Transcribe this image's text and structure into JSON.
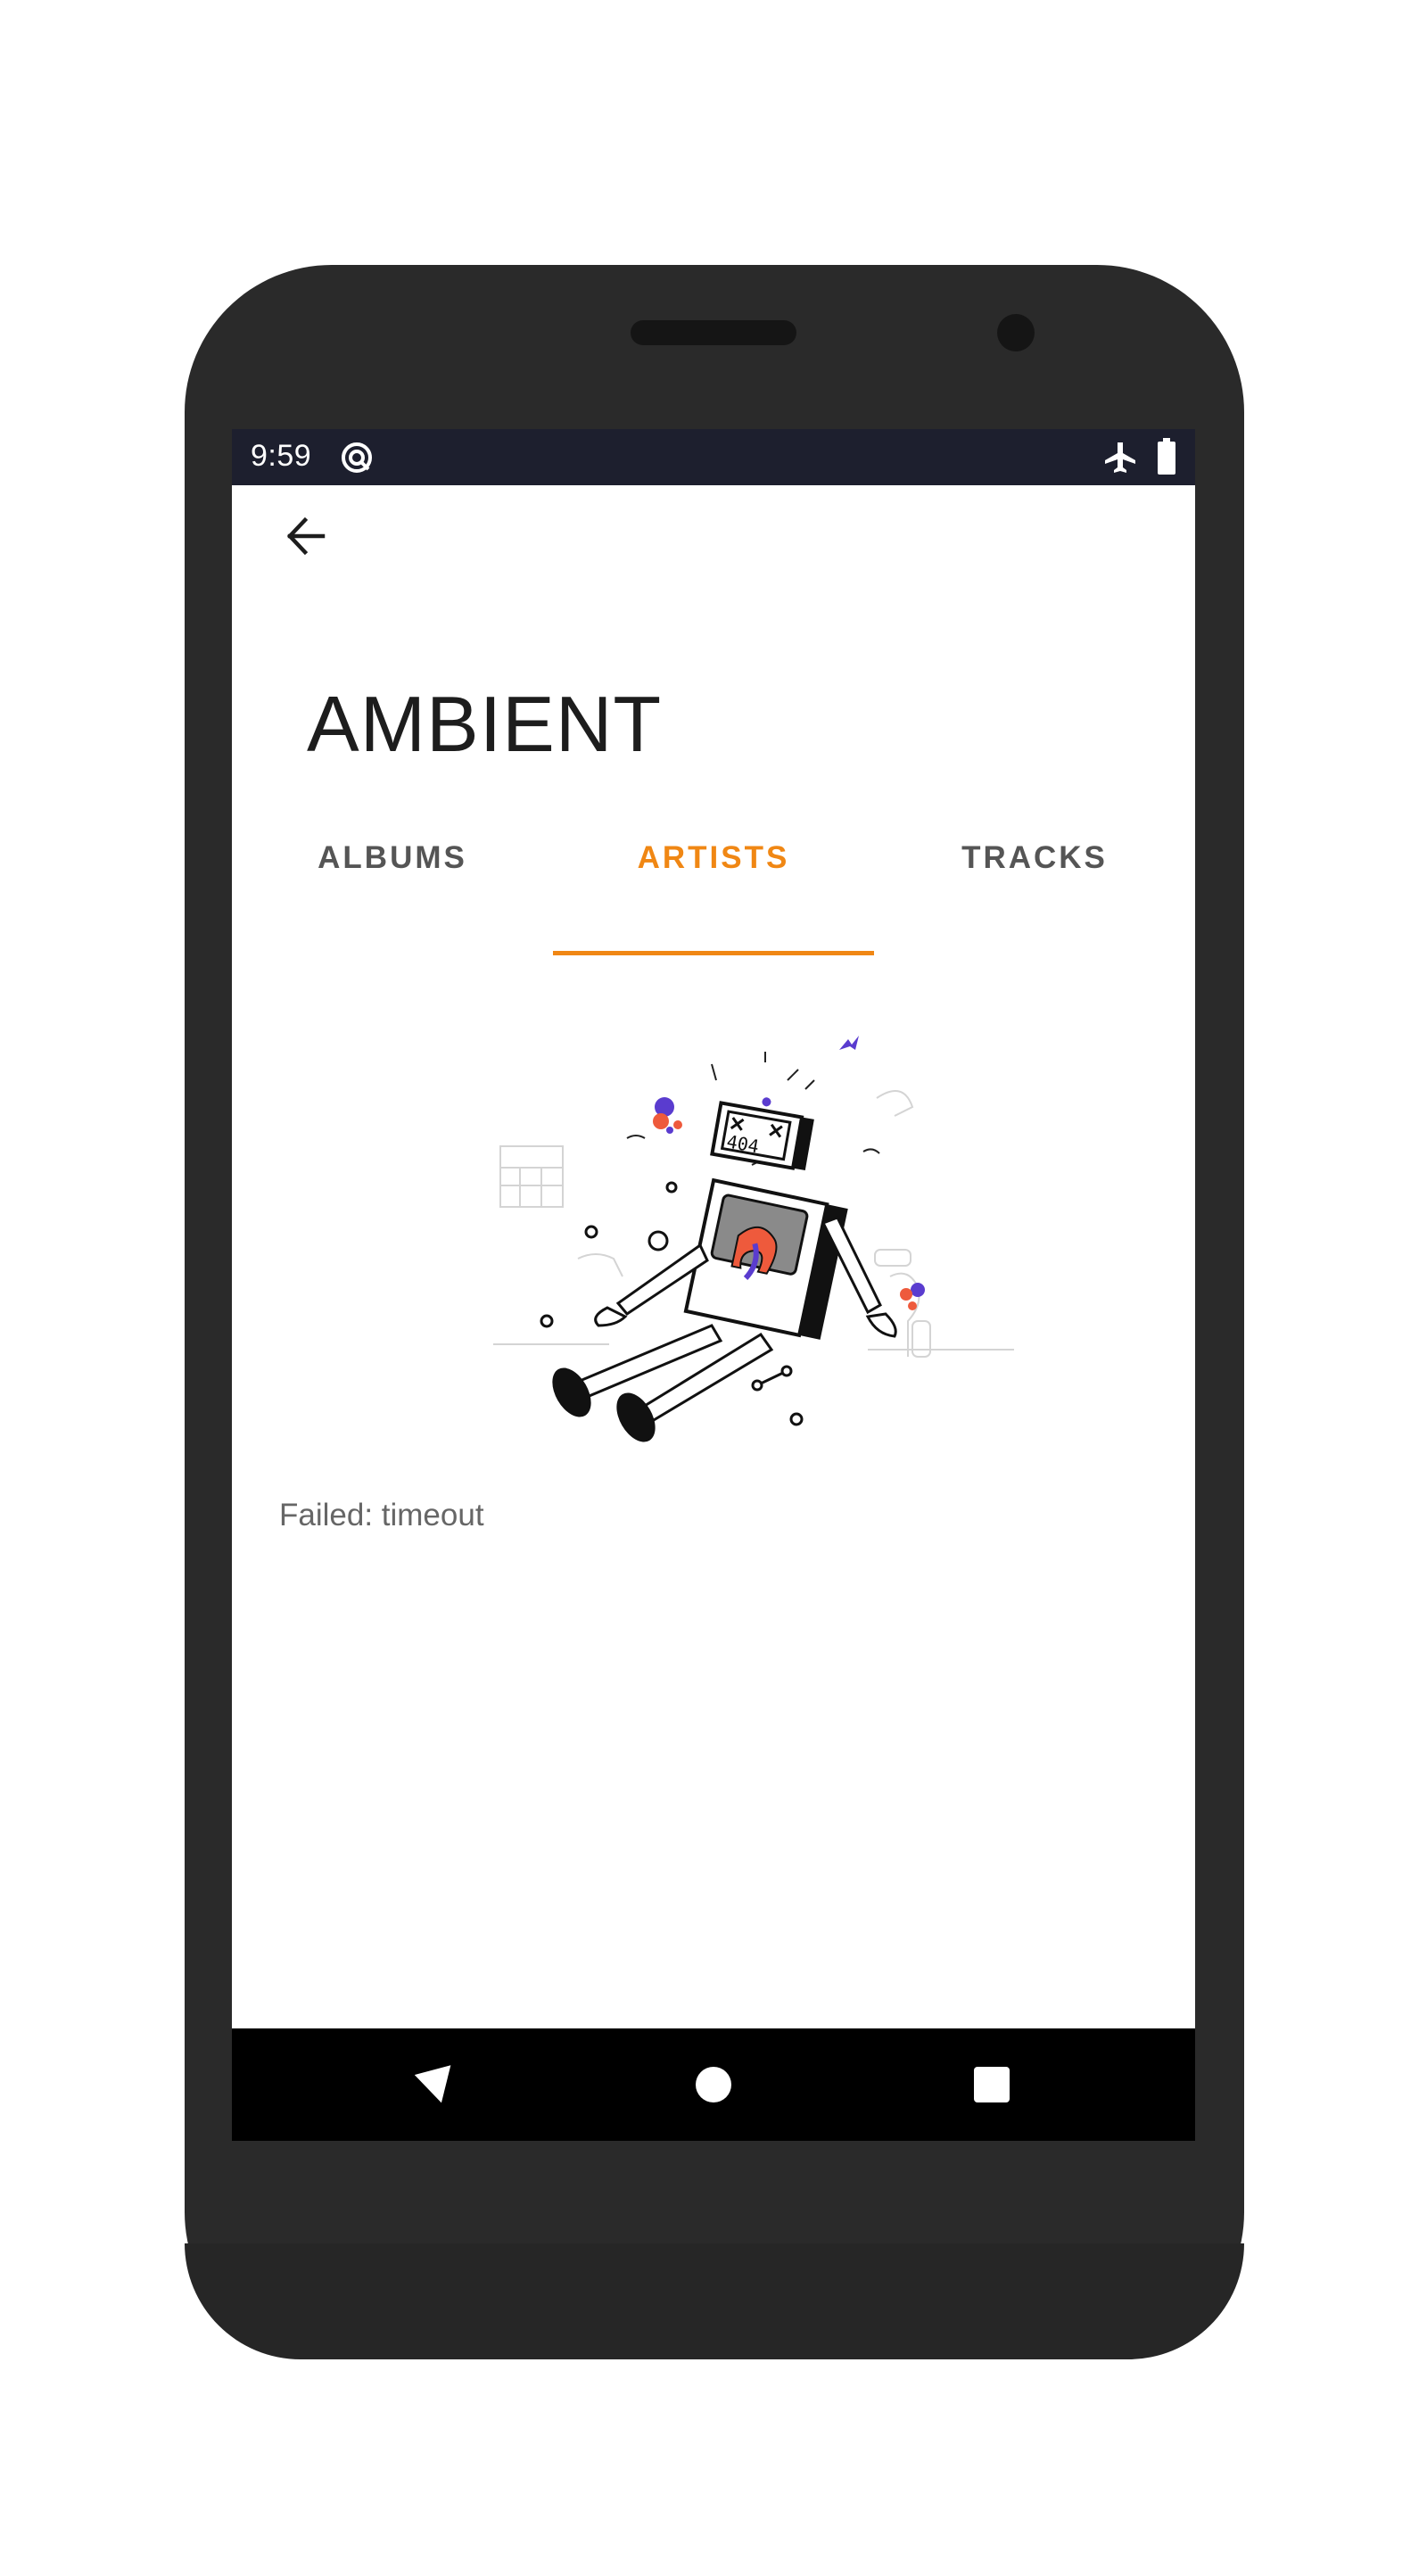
{
  "status_bar": {
    "time": "9:59",
    "icons": [
      "sync-icon",
      "airplane-mode-icon",
      "battery-icon"
    ]
  },
  "toolbar": {
    "back_icon": "arrow-left-icon"
  },
  "page": {
    "title": "AMBIENT"
  },
  "tabs": [
    {
      "label": "ALBUMS",
      "active": false
    },
    {
      "label": "ARTISTS",
      "active": true
    },
    {
      "label": "TRACKS",
      "active": false
    }
  ],
  "error_state": {
    "illustration": "broken-robot-404-illustration",
    "robot_screen_text": "404",
    "message": "Failed: timeout"
  },
  "nav_bar": {
    "icons": [
      "nav-back-icon",
      "nav-home-icon",
      "nav-recents-icon"
    ]
  },
  "colors": {
    "accent": "#f08714",
    "status_bar": "#1d1f2e",
    "tab_inactive": "#555555",
    "title": "#1d1d1d",
    "error_text": "#666666"
  }
}
